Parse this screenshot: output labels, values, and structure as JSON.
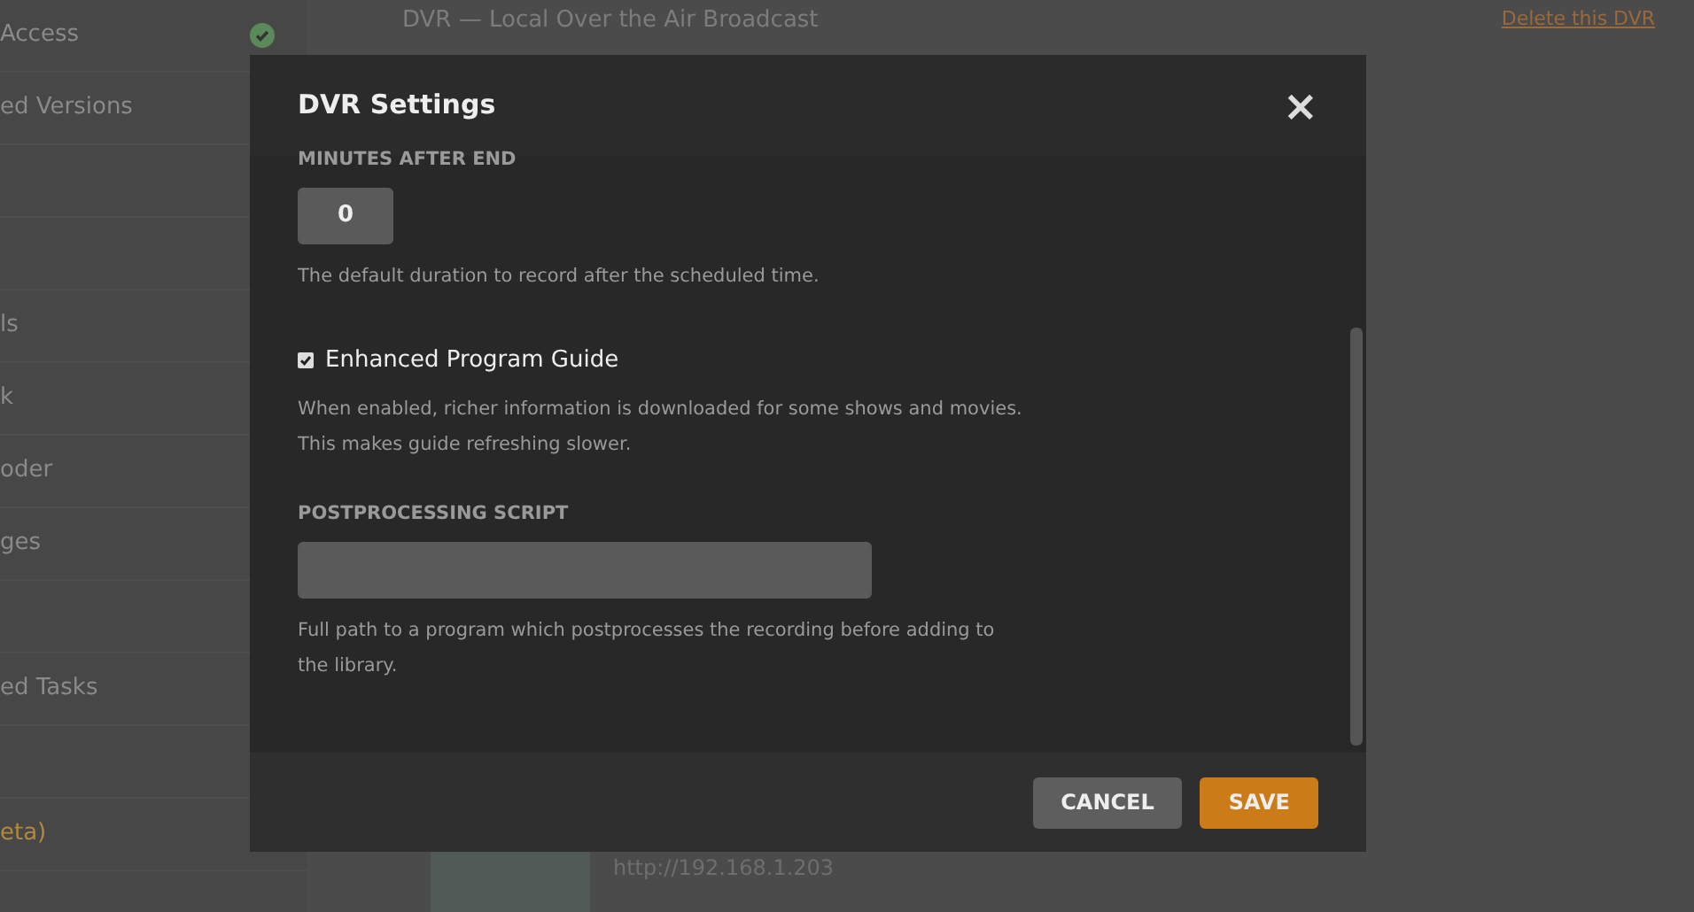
{
  "sidebar": {
    "items": [
      {
        "kind": "entry",
        "label": "Access",
        "status_ok": true,
        "highlight": false
      },
      {
        "kind": "entry",
        "label": "ed Versions",
        "highlight": false
      },
      {
        "kind": "blank"
      },
      {
        "kind": "blank"
      },
      {
        "kind": "entry",
        "label": "ls",
        "highlight": false
      },
      {
        "kind": "entry",
        "label": "k",
        "highlight": false
      },
      {
        "kind": "entry",
        "label": "oder",
        "highlight": false
      },
      {
        "kind": "entry",
        "label": "ges",
        "highlight": false
      },
      {
        "kind": "blank"
      },
      {
        "kind": "entry",
        "label": "ed Tasks",
        "highlight": false
      },
      {
        "kind": "blank"
      },
      {
        "kind": "entry",
        "label": "eta)",
        "highlight": true
      }
    ]
  },
  "page": {
    "title": "DVR — Local Over the Air Broadcast",
    "delete_link": "Delete this DVR",
    "device_url": "http://192.168.1.203"
  },
  "dialog": {
    "title": "DVR Settings",
    "close": "×",
    "sections": [
      {
        "kind": "number",
        "label": "MINUTES AFTER END",
        "value": "0",
        "help": "The default duration to record after the scheduled time."
      },
      {
        "kind": "checkbox",
        "label": "Enhanced Program Guide",
        "checked": true,
        "help": "When enabled, richer information is downloaded for some shows and movies. This makes guide refreshing slower."
      },
      {
        "kind": "text",
        "label": "POSTPROCESSING SCRIPT",
        "help": "Full path to a program which postprocesses the recording before adding to the library."
      }
    ],
    "buttons": [
      {
        "label": "CANCEL",
        "kind": "secondary"
      },
      {
        "label": "SAVE",
        "kind": "primary"
      }
    ]
  }
}
